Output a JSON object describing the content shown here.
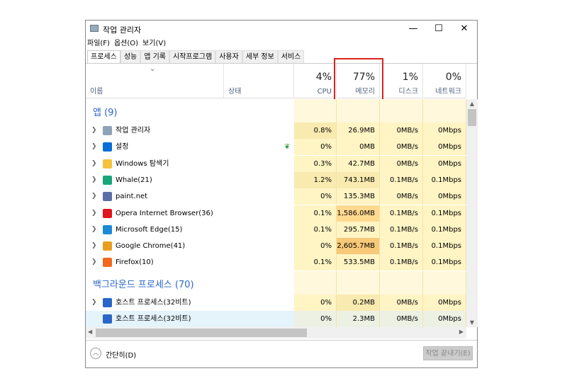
{
  "window": {
    "title": "작업 관리자",
    "minimize": "—",
    "maximize": "☐",
    "close": "✕"
  },
  "menu": [
    "파일(F)",
    "옵션(O)",
    "보기(V)"
  ],
  "tabs": [
    "프로세스",
    "성능",
    "앱 기록",
    "시작프로그램",
    "사용자",
    "세부 정보",
    "서비스"
  ],
  "header": {
    "sort_arrow": "⌄",
    "name": "이름",
    "status": "상태",
    "cpu": {
      "pct": "4%",
      "label": "CPU"
    },
    "memory": {
      "pct": "77%",
      "label": "메모리"
    },
    "disk": {
      "pct": "1%",
      "label": "디스크"
    },
    "network": {
      "pct": "0%",
      "label": "네트워크"
    }
  },
  "groups": {
    "apps": "앱 (9)",
    "background": "백그라운드 프로세스 (70)"
  },
  "apps": [
    {
      "name": "작업 관리자",
      "icon": "task-manager-icon",
      "color": "#8fa3b8",
      "cpu": "0.8%",
      "mem": "26.9MB",
      "disk": "0MB/s",
      "net": "0Mbps",
      "heat": [
        2,
        1,
        1,
        1
      ]
    },
    {
      "name": "설정",
      "icon": "settings-icon",
      "color": "#0a6fd6",
      "cpu": "0%",
      "mem": "0MB",
      "disk": "0MB/s",
      "net": "0Mbps",
      "heat": [
        1,
        1,
        1,
        1
      ],
      "status_icon": "leaf-icon"
    },
    {
      "name": "Windows 탐색기",
      "icon": "folder-icon",
      "color": "#f3c33c",
      "cpu": "0.3%",
      "mem": "42.7MB",
      "disk": "0MB/s",
      "net": "0Mbps",
      "heat": [
        1,
        1,
        1,
        1
      ]
    },
    {
      "name": "Whale(21)",
      "icon": "whale-icon",
      "color": "#1aa67a",
      "cpu": "1.2%",
      "mem": "743.1MB",
      "disk": "0.1MB/s",
      "net": "0.1Mbps",
      "heat": [
        2,
        2,
        1,
        1
      ]
    },
    {
      "name": "paint.net",
      "icon": "paintnet-icon",
      "color": "#5a6fa8",
      "cpu": "0%",
      "mem": "135.3MB",
      "disk": "0MB/s",
      "net": "0Mbps",
      "heat": [
        1,
        1,
        1,
        1
      ]
    },
    {
      "name": "Opera Internet Browser(36)",
      "icon": "opera-icon",
      "color": "#e0141e",
      "cpu": "0.1%",
      "mem": "1,586.0MB",
      "disk": "0.1MB/s",
      "net": "0.1Mbps",
      "heat": [
        1,
        3,
        1,
        1
      ]
    },
    {
      "name": "Microsoft Edge(15)",
      "icon": "edge-icon",
      "color": "#1c8ad6",
      "cpu": "0.1%",
      "mem": "295.7MB",
      "disk": "0.1MB/s",
      "net": "0.1Mbps",
      "heat": [
        1,
        1,
        1,
        1
      ]
    },
    {
      "name": "Google Chrome(41)",
      "icon": "chrome-icon",
      "color": "#e8a020",
      "cpu": "0%",
      "mem": "2,605.7MB",
      "disk": "0.1MB/s",
      "net": "0.1Mbps",
      "heat": [
        1,
        4,
        1,
        1
      ]
    },
    {
      "name": "Firefox(10)",
      "icon": "firefox-icon",
      "color": "#f06a1e",
      "cpu": "0.1%",
      "mem": "533.5MB",
      "disk": "0.1MB/s",
      "net": "0.1Mbps",
      "heat": [
        1,
        1,
        1,
        1
      ]
    }
  ],
  "background": [
    {
      "name": "호스트 프로세스(32비트)",
      "icon": "host-process-icon",
      "color": "#2a66c8",
      "cpu": "0%",
      "mem": "0.2MB",
      "disk": "0MB/s",
      "net": "0Mbps",
      "heat": [
        1,
        2,
        1,
        1
      ],
      "expand": true
    },
    {
      "name": "호스트 프로세스(32비트)",
      "icon": "host-process-icon",
      "color": "#2a66c8",
      "cpu": "0%",
      "mem": "2.3MB",
      "disk": "0MB/s",
      "net": "0Mbps",
      "heat": [
        0,
        0,
        0,
        0
      ],
      "selected": true
    }
  ],
  "footer": {
    "fewer_details": "간단히(D)",
    "end_task": "작업 끝내기(E)"
  },
  "heat_colors": [
    "#edf1e4",
    "#fff4c4",
    "#f9eab0",
    "#ffd98e",
    "#f7c978"
  ]
}
